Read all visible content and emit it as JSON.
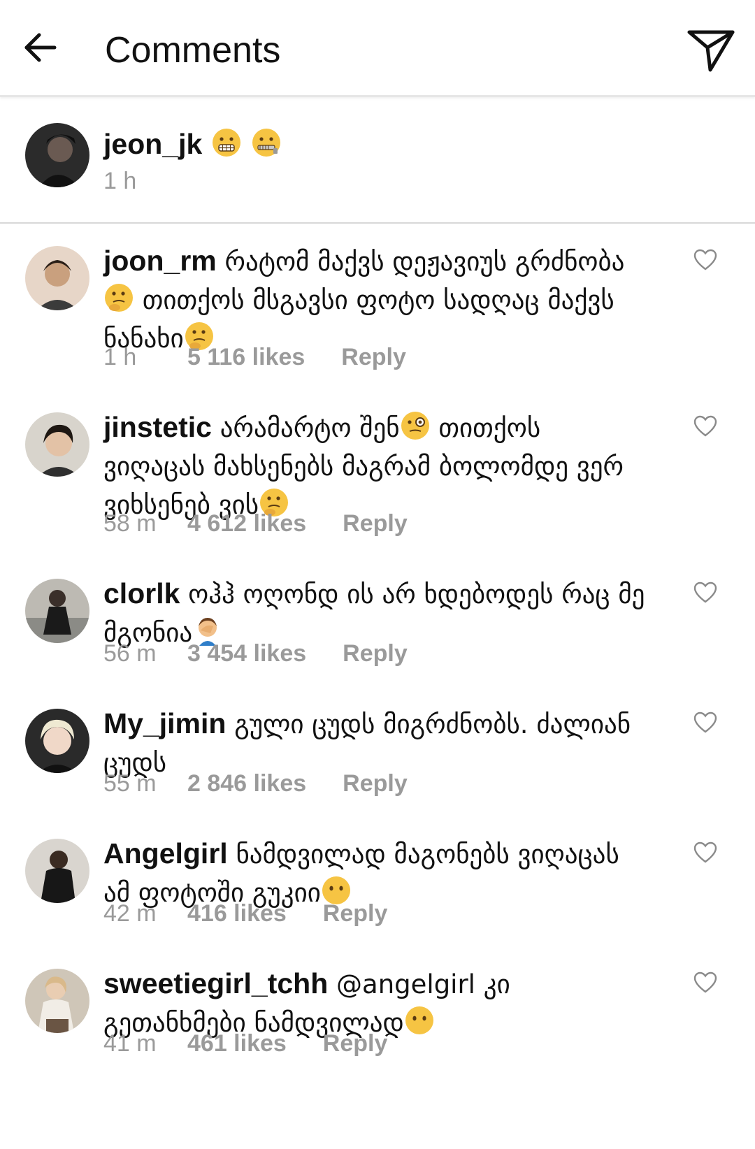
{
  "header": {
    "title": "Comments",
    "back_icon": "arrow-left-icon",
    "send_icon": "paper-plane-icon"
  },
  "caption": {
    "username": "jeon_jk",
    "emojis": [
      "grimacing-face",
      "zipper-mouth-face"
    ],
    "time": "1 h"
  },
  "comments": [
    {
      "username": "joon_rm",
      "text_parts": [
        "რატომ მაქვს დეჟავიუს გრძნობა",
        "🤔",
        " თითქოს მსგავსი ფოტო სადღაც მაქვს ნანახი",
        "🤔"
      ],
      "time": "1 h",
      "likes": "5 116 likes",
      "reply": "Reply"
    },
    {
      "username": "jinstetic",
      "text_parts": [
        "არამარტო შენ",
        "🧐",
        " თითქოს ვიღაცას მახსენებს მაგრამ ბოლომდე ვერ ვიხსენებ ვის",
        "🤔"
      ],
      "time": "58 m",
      "likes": "4 612 likes",
      "reply": "Reply"
    },
    {
      "username": "clorlk",
      "text_parts": [
        "ოჰჰ ოღონდ ის არ ხდებოდეს რაც მე მგონია",
        "🤦"
      ],
      "time": "56 m",
      "likes": "3 454 likes",
      "reply": "Reply"
    },
    {
      "username": "My_jimin",
      "text_parts": [
        "გული ცუდს მიგრძნობს. ძალიან ცუდს"
      ],
      "time": "55 m",
      "likes": "2 846 likes",
      "reply": "Reply"
    },
    {
      "username": "Angelgirl",
      "text_parts": [
        "ნამდვილად მაგონებს ვიღაცას ამ ფოტოში გუკიი",
        "😶"
      ],
      "time": "42 m",
      "likes": "416 likes",
      "reply": "Reply"
    },
    {
      "username": "sweetiegirl_tchh",
      "text_parts": [
        "@angelgirl კი გეთანხმები ნამდვილად",
        "😶"
      ],
      "time": "41 m",
      "likes": "461 likes",
      "reply": "Reply"
    }
  ],
  "colors": {
    "text": "#111111",
    "muted": "#9a9a9a",
    "divider": "#d8d8d8",
    "emoji": "#f6c443"
  },
  "icons": {
    "like": "heart-outline-icon"
  }
}
